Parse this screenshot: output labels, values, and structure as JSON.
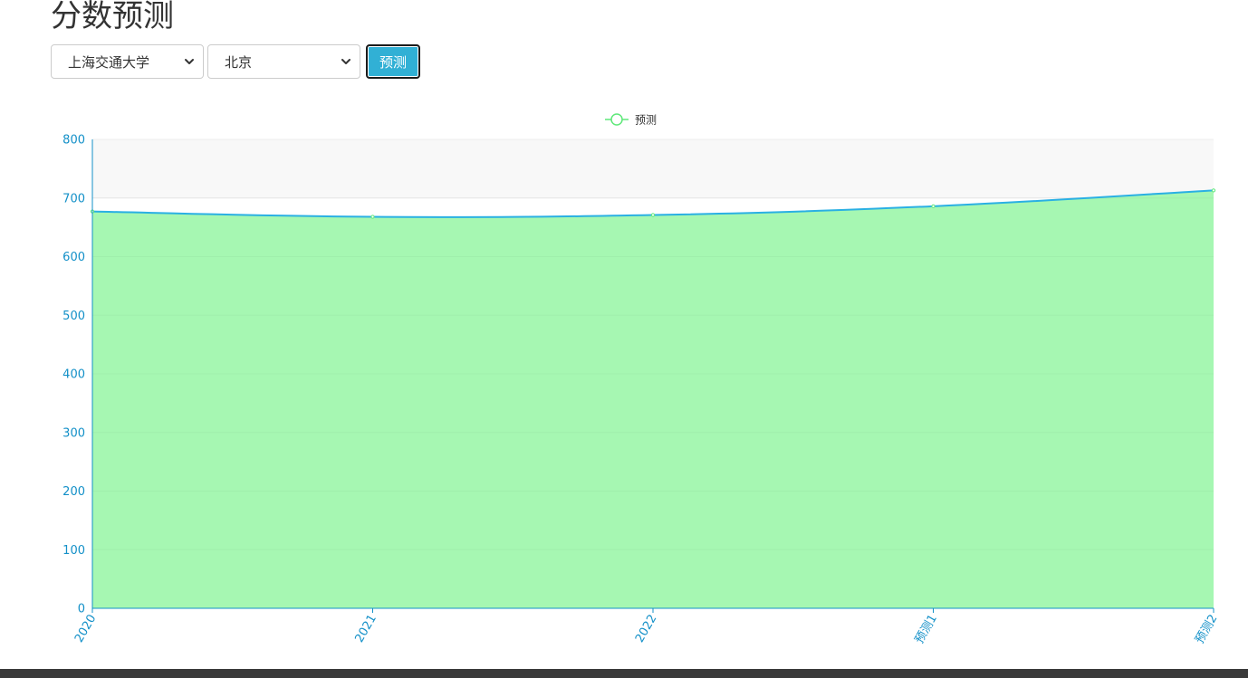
{
  "page": {
    "title": "分数预测"
  },
  "controls": {
    "university_select": {
      "value": "上海交通大学"
    },
    "region_select": {
      "value": "北京"
    },
    "predict_button": {
      "label": "预测"
    }
  },
  "colors": {
    "line": "#2ab0e3",
    "area": "#a3f7b0",
    "axis": "#1390c8",
    "legend_marker": "#5fe87a",
    "band": "#f8f8f8",
    "button": "#31b0d5",
    "footer": "#3a3a3a"
  },
  "chart_data": {
    "type": "area",
    "categories": [
      "2020",
      "2021",
      "2022",
      "预测1",
      "预测2"
    ],
    "series": [
      {
        "name": "预测",
        "values": [
          677,
          668,
          671,
          686,
          713
        ]
      }
    ],
    "ylim": [
      0,
      800
    ],
    "y_ticks": [
      0,
      100,
      200,
      300,
      400,
      500,
      600,
      700,
      800
    ],
    "legend_position": "top-center",
    "grid": true,
    "x_tick_rotation_deg": -60
  }
}
